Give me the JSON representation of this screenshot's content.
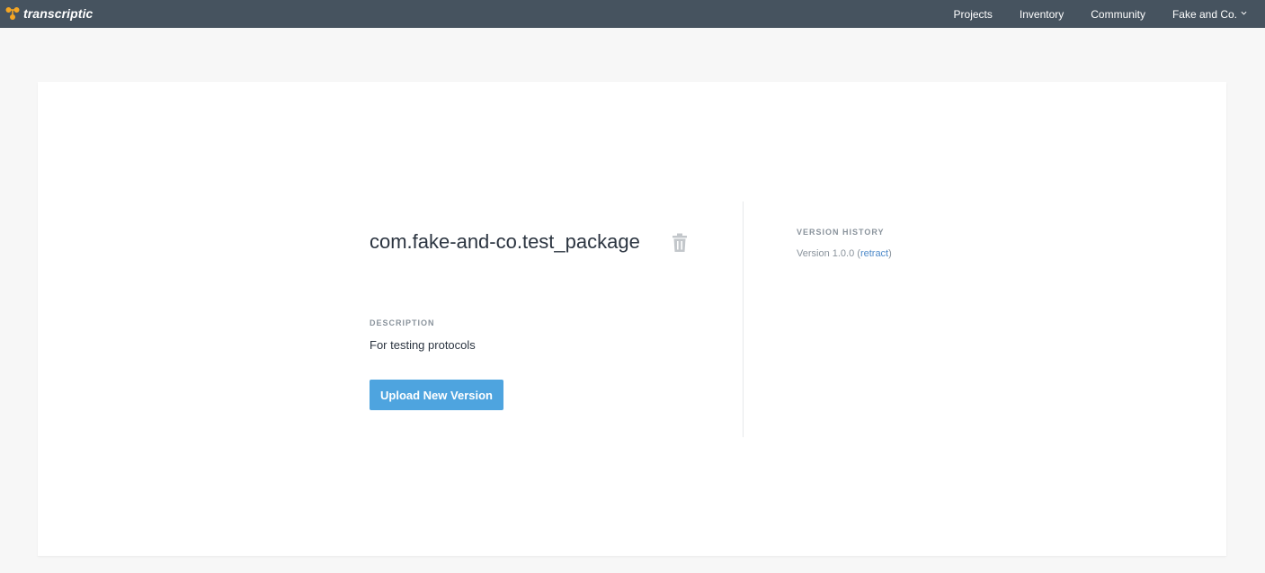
{
  "header": {
    "brand": "transcriptic",
    "nav": {
      "projects": "Projects",
      "inventory": "Inventory",
      "community": "Community",
      "account": "Fake and Co."
    }
  },
  "package": {
    "name": "com.fake-and-co.test_package",
    "description_label": "DESCRIPTION",
    "description": "For testing protocols",
    "upload_label": "Upload New Version"
  },
  "version_history": {
    "label": "VERSION HISTORY",
    "entries": [
      {
        "prefix": "Version 1.0.0 (",
        "action": "retract",
        "suffix": ")"
      }
    ]
  },
  "colors": {
    "topbar": "#46535f",
    "brand_logo": "#f5a623",
    "primary_button": "#4ea4df",
    "link": "#4e8ac9"
  },
  "icons": {
    "brand_logo": "transcriptic-logo-icon",
    "account_caret": "chevron-down-icon",
    "delete": "trash-icon"
  }
}
